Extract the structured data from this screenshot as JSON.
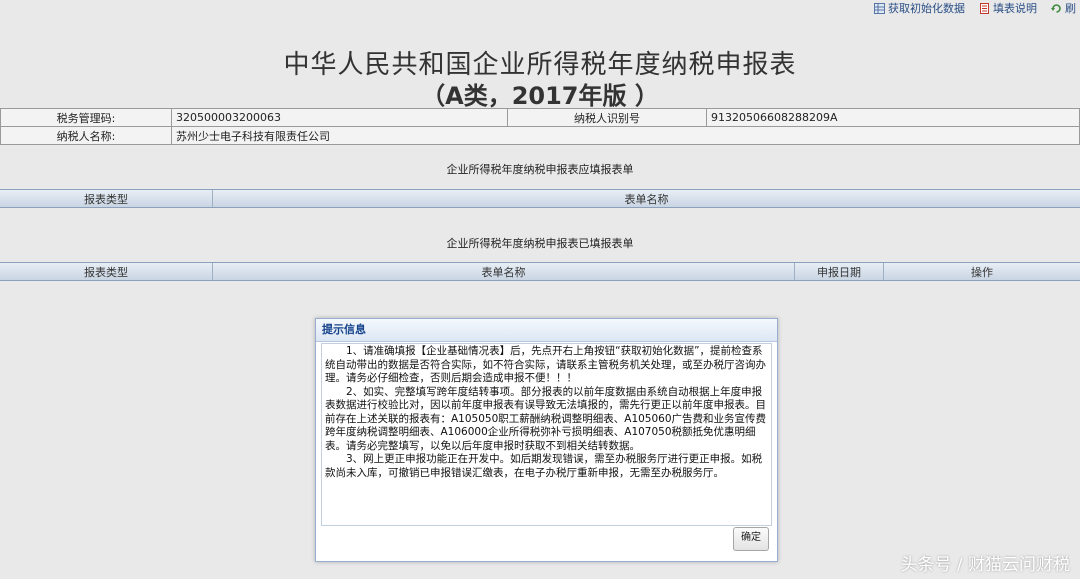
{
  "toolbar": {
    "fetch_init_label": "获取初始化数据",
    "fill_guide_label": "填表说明",
    "refresh_label": "刷"
  },
  "title": {
    "line1": "中华人民共和国企业所得税年度纳税申报表",
    "line2": "（A类，2017年版 ）"
  },
  "taxpayer": {
    "tax_code_label": "税务管理码:",
    "tax_code_value": "320500003200063",
    "taxpayer_id_label": "纳税人识别号",
    "taxpayer_id_value": "91320506608288209A",
    "name_label": "纳税人名称:",
    "name_value": "苏州少士电子科技有限责任公司"
  },
  "should_fill": {
    "title": "企业所得税年度纳税申报表应填报表单",
    "col_type": "报表类型",
    "col_name": "表单名称"
  },
  "filled": {
    "title": "企业所得税年度纳税申报表已填报表单",
    "col_type": "报表类型",
    "col_name": "表单名称",
    "col_date": "申报日期",
    "col_action": "操作"
  },
  "dialog": {
    "title": "提示信息",
    "para1": "1、请准确填报【企业基础情况表】后，先点开右上角按钮“获取初始化数据”，提前检查系统自动带出的数据是否符合实际，如不符合实际，请联系主管税务机关处理，或至办税厅咨询办理。请务必仔细检查，否则后期会造成申报不便！！！",
    "para2": "2、如实、完整填写跨年度结转事项。部分报表的以前年度数据由系统自动根据上年度申报表数据进行校验比对，因以前年度申报表有误导致无法填报的，需先行更正以前年度申报表。目前存在上述关联的报表有：A105050职工薪酬纳税调整明细表、A105060广告费和业务宣传费跨年度纳税调整明细表、A106000企业所得税弥补亏损明细表、A107050税额抵免优惠明细表。请务必完整填写，以免以后年度申报时获取不到相关结转数据。",
    "para3": "3、网上更正申报功能正在开发中。如后期发现错误，需至办税服务厅进行更正申报。如税款尚未入库，可撤销已申报错误汇缴表，在电子办税厅重新申报，无需至办税服务厅。",
    "ok_label": "确定"
  },
  "watermark": "头条号 / 财猫云问财税"
}
